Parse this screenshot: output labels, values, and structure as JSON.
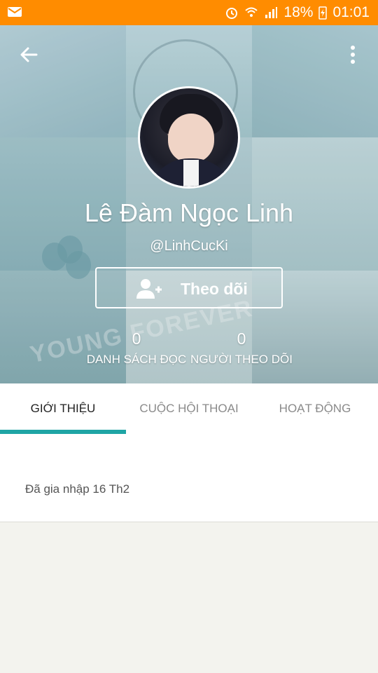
{
  "status_bar": {
    "battery": "18%",
    "time": "01:01",
    "icons": [
      "mail-icon",
      "alarm-icon",
      "wifi-icon",
      "signal-icon",
      "battery-charging-icon"
    ]
  },
  "header": {
    "back_icon": "arrow-left-icon",
    "more_icon": "more-vertical-icon"
  },
  "profile": {
    "display_name": "Lê Đàm Ngọc Linh",
    "username": "@LinhCucKi",
    "follow_label": "Theo dõi",
    "follow_icon": "add-user-icon",
    "stats": [
      {
        "value": "0",
        "label": "DANH SÁCH ĐỌC"
      },
      {
        "value": "0",
        "label": "NGƯỜI THEO DÕI"
      }
    ],
    "background_text": "YOUNG FOREVER"
  },
  "tabs": [
    {
      "label": "GIỚI THIỆU",
      "active": true
    },
    {
      "label": "CUỘC HỘI THOẠI",
      "active": false
    },
    {
      "label": "HOẠT ĐỘNG",
      "active": false
    }
  ],
  "about": {
    "joined": "Đã gia nhập 16 Th2"
  },
  "colors": {
    "status_bar": "#ff8c00",
    "accent": "#1fa5a5"
  }
}
